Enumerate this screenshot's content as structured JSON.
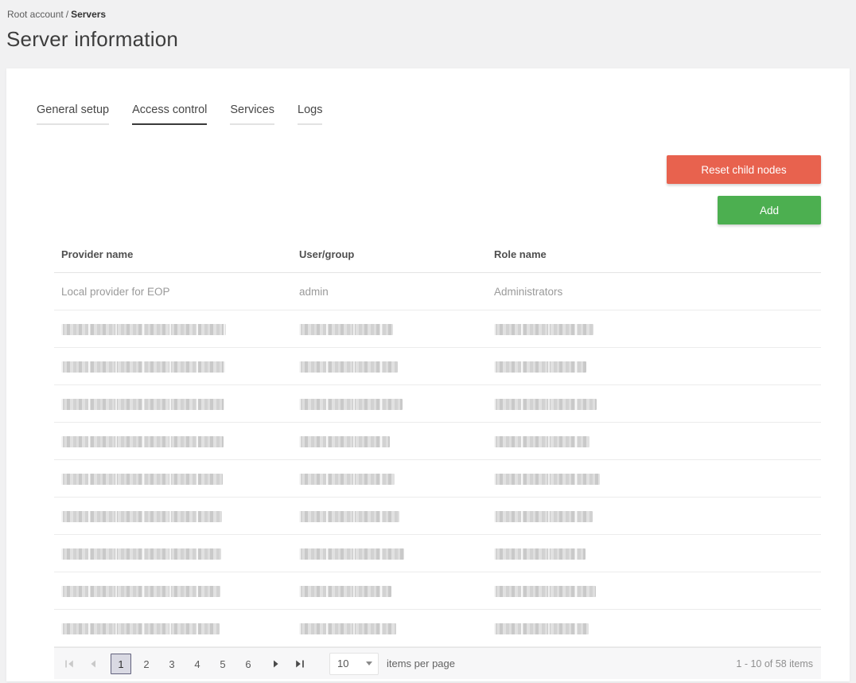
{
  "breadcrumb": {
    "root": "Root account",
    "separator": "/",
    "current": "Servers"
  },
  "page": {
    "title": "Server information"
  },
  "tabs": [
    {
      "label": "General setup",
      "active": false
    },
    {
      "label": "Access control",
      "active": true
    },
    {
      "label": "Services",
      "active": false
    },
    {
      "label": "Logs",
      "active": false
    }
  ],
  "actions": {
    "reset_label": "Reset child nodes",
    "add_label": "Add"
  },
  "table": {
    "columns": [
      "Provider name",
      "User/group",
      "Role name"
    ],
    "rows": [
      {
        "redacted": false,
        "cells": [
          "Local provider for EOP",
          "admin",
          "Administrators"
        ]
      },
      {
        "redacted": true,
        "cells": [
          "",
          "",
          ""
        ]
      },
      {
        "redacted": true,
        "cells": [
          "",
          "",
          ""
        ]
      },
      {
        "redacted": true,
        "cells": [
          "",
          "",
          ""
        ]
      },
      {
        "redacted": true,
        "cells": [
          "",
          "",
          ""
        ]
      },
      {
        "redacted": true,
        "cells": [
          "",
          "",
          ""
        ]
      },
      {
        "redacted": true,
        "cells": [
          "",
          "",
          ""
        ]
      },
      {
        "redacted": true,
        "cells": [
          "",
          "",
          ""
        ]
      },
      {
        "redacted": true,
        "cells": [
          "",
          "",
          ""
        ]
      },
      {
        "redacted": true,
        "cells": [
          "",
          "",
          ""
        ]
      }
    ]
  },
  "pager": {
    "pages": [
      "1",
      "2",
      "3",
      "4",
      "5",
      "6"
    ],
    "current_page": "1",
    "page_size": "10",
    "items_per_page_label": "items per page",
    "summary": "1 - 10 of 58 items"
  },
  "colors": {
    "reset_button": "#e8624e",
    "add_button": "#4caf50",
    "selected_page_bg": "#d9d9e3",
    "selected_page_border": "#62627d"
  }
}
